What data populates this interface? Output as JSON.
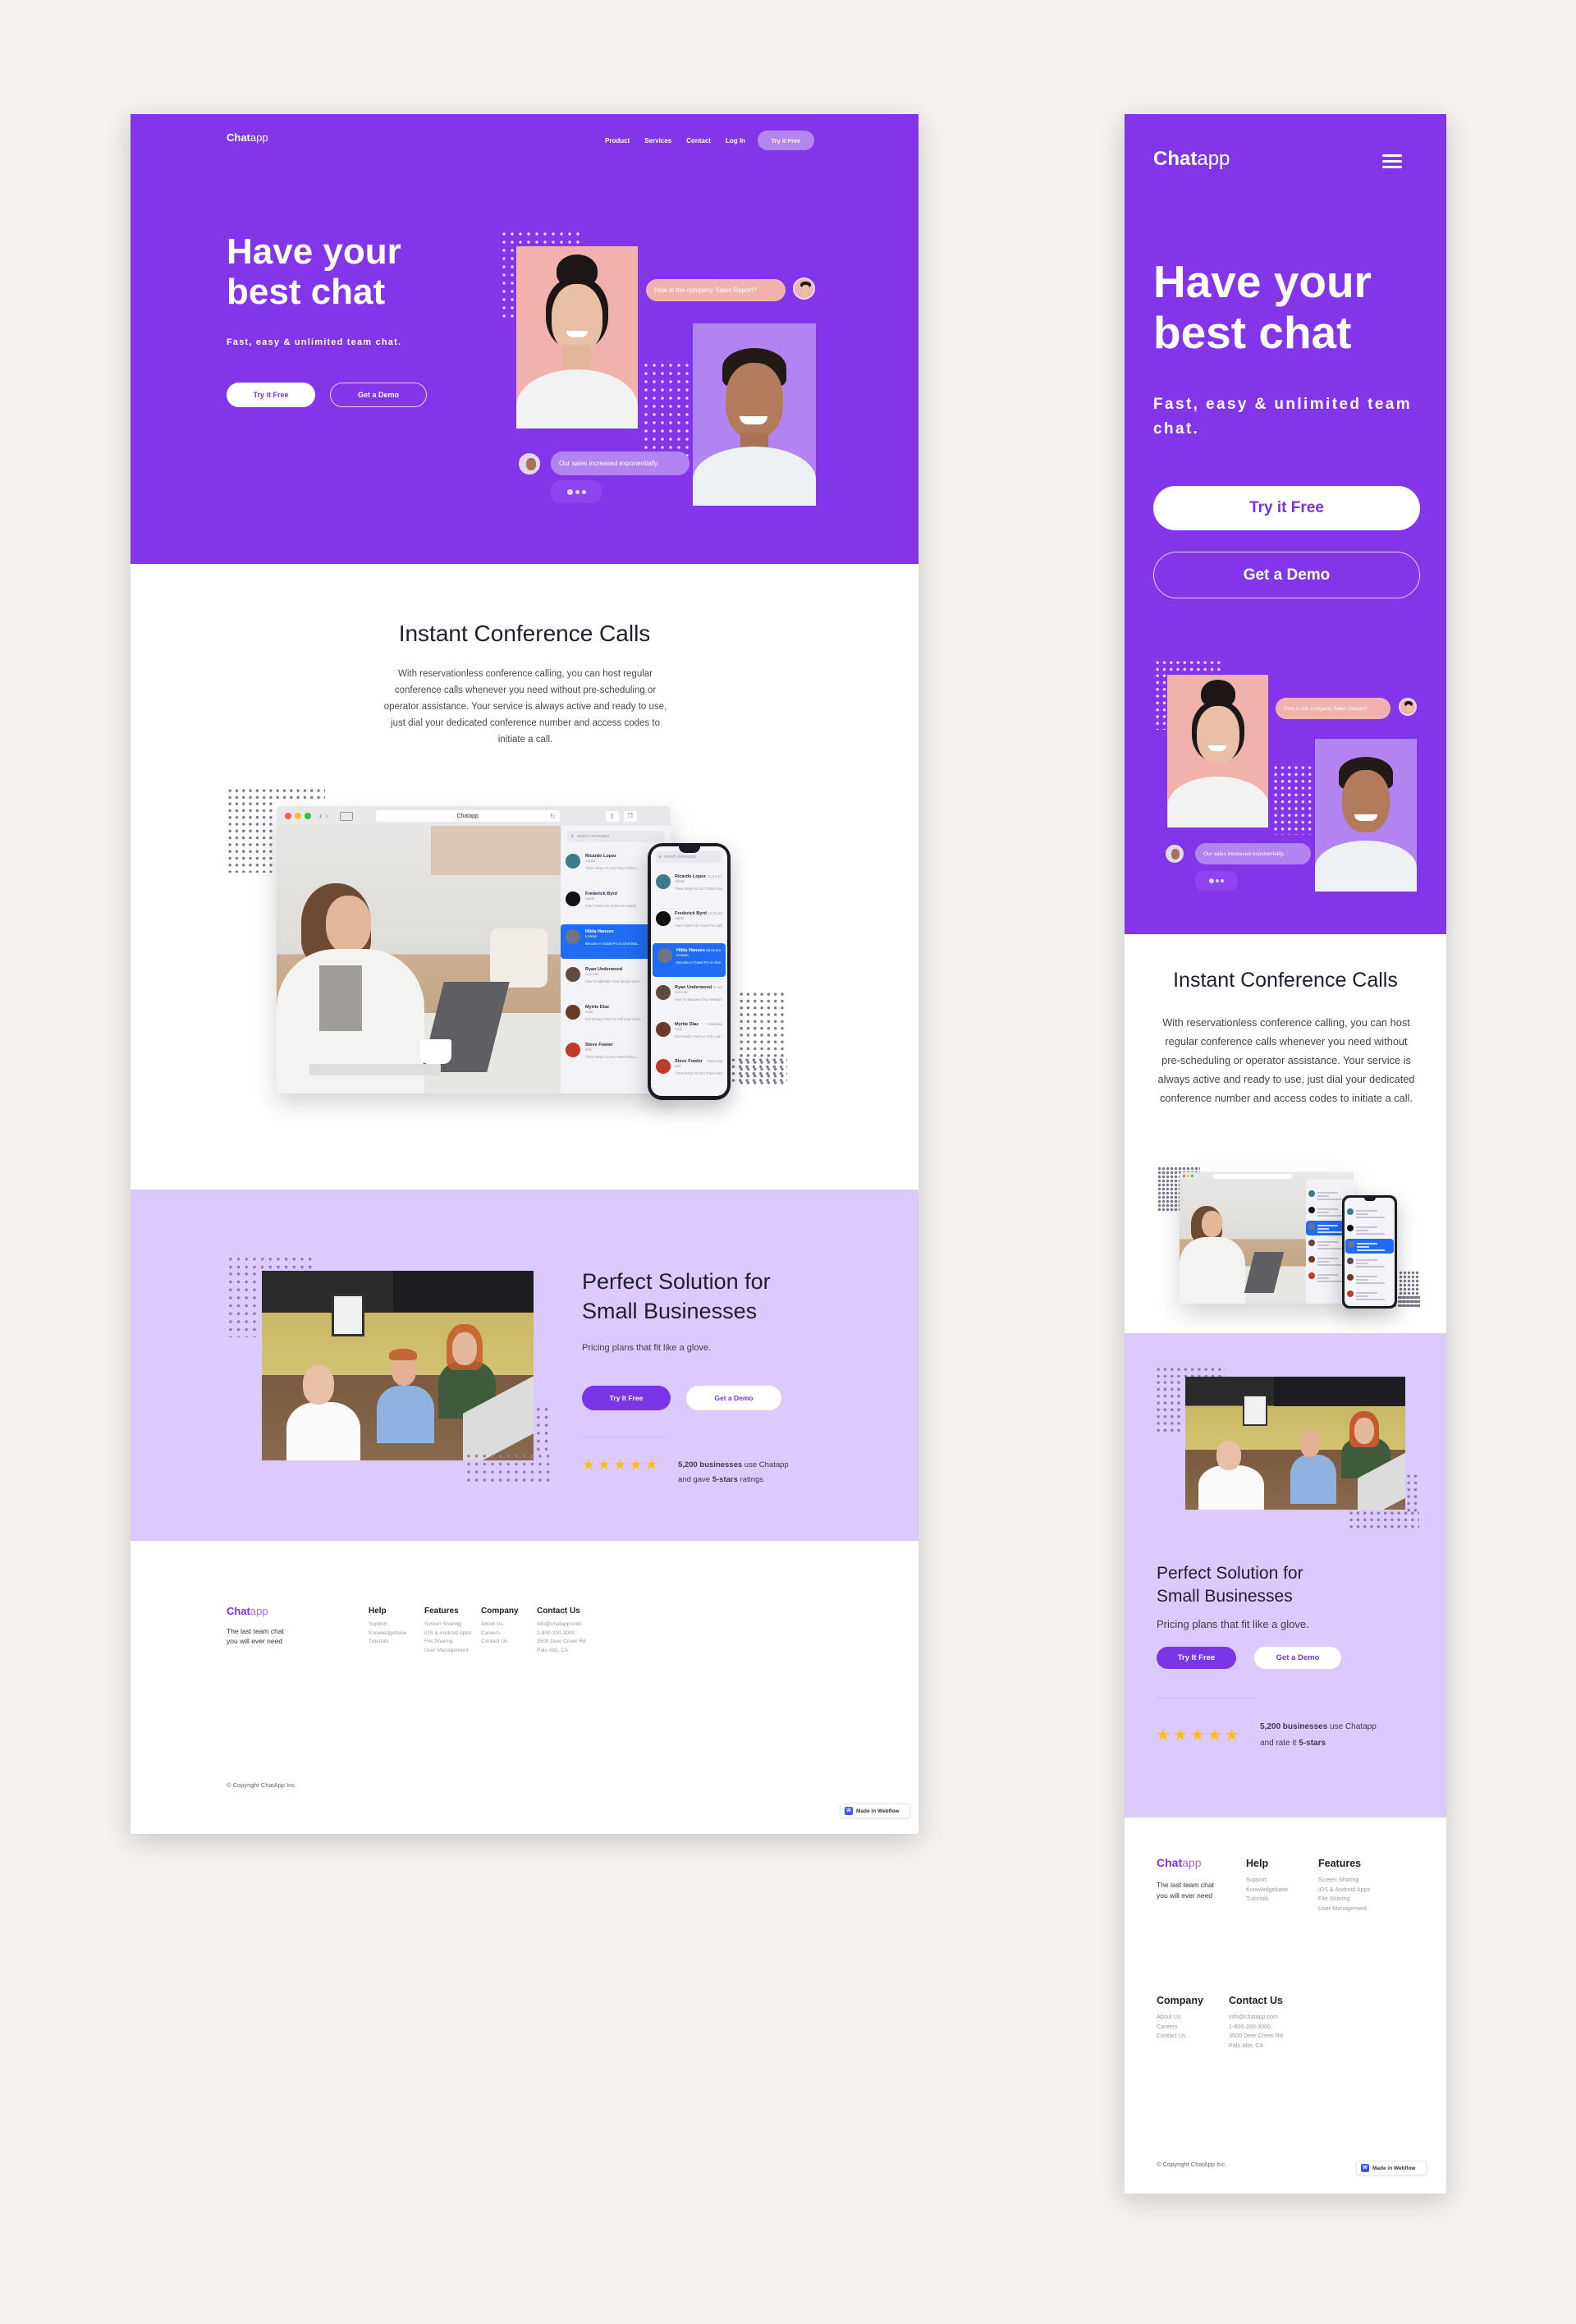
{
  "brand": {
    "name_bold": "Chat",
    "name_light": "app",
    "primary": "#8336e8",
    "lilac": "#dccafc",
    "accent_blue": "#1f6cf5"
  },
  "nav": {
    "items": [
      "Product",
      "Services",
      "Contact",
      "Log In"
    ],
    "cta": "Try it Free",
    "menu_icon": "hamburger-icon"
  },
  "hero": {
    "title_line1": "Have your",
    "title_line2": "best chat",
    "subtitle": "Fast, easy & unlimited team chat.",
    "primary_button": "Try it Free",
    "secondary_button": "Get a Demo",
    "bubble_question": "How is the company Sales Report?",
    "bubble_answer": "Our sales increased exponentially.",
    "typing_indicator": "typing-dots"
  },
  "conference": {
    "title": "Instant Conference Calls",
    "body": "With reservationless conference calling, you can host regular conference calls whenever you need without pre-scheduling or operator assistance. Your service is always active and ready to use, just dial your dedicated conference number and access codes to initiate a call.",
    "browser_title": "Chatapp",
    "search_placeholder": "search messages",
    "chats": [
      {
        "name": "Ricardo Lopez",
        "company": "Adobe",
        "preview": "Three Ways To Get Travel Disco...",
        "time": "11:23 am",
        "active": false
      },
      {
        "name": "Frederick Byrd",
        "company": "Apple",
        "preview": "Train Travel On Track For Safety",
        "time": "10:11 am",
        "active": false
      },
      {
        "name": "Hilda Hansen",
        "company": "Invision",
        "preview": "Become A Travel Pro In One Eas...",
        "time": "08:43 am",
        "active": true
      },
      {
        "name": "Ryan Underwood",
        "company": "Avocode",
        "preview": "How To Maintain Your Mental Heal...",
        "time": "7:11 am",
        "active": false
      },
      {
        "name": "Myrtie Diaz",
        "company": "Audi",
        "preview": "Get Ready Fast For Fall Leaf Viewi...",
        "time": "Yesterday",
        "active": false
      },
      {
        "name": "Steve Fowler",
        "company": "Dell",
        "preview": "Three Ways To Get Travel Disco...",
        "time": "Yesterday",
        "active": false
      }
    ]
  },
  "solution": {
    "title_line1": "Perfect Solution for",
    "title_line2": "Small Businesses",
    "subtitle": "Pricing plans that fit like a glove.",
    "primary_button": "Try It Free",
    "secondary_button": "Get a Demo",
    "rating": 5,
    "rating_max": 5,
    "stat_bold": "5,200 businesses",
    "stat_rest": " use Chatapp",
    "desktop_line2_pre": "and gave ",
    "desktop_line2_bold": "5-stars",
    "desktop_line2_post": " ratings",
    "mobile_line2_pre": "and rate it ",
    "mobile_line2_bold": "5-stars"
  },
  "footer": {
    "tagline_line1": "The last team chat",
    "tagline_line2": "you will ever need",
    "columns": [
      {
        "title": "Help",
        "links": [
          "Support",
          "Knowledgebase",
          "Tutorials"
        ]
      },
      {
        "title": "Features",
        "links": [
          "Screen Sharing",
          "iOS & Android Apps",
          "File Sharing",
          "User Management"
        ]
      },
      {
        "title": "Company",
        "links": [
          "About Us",
          "Careers",
          "Contact Us"
        ]
      },
      {
        "title": "Contact Us",
        "links": [
          "info@chatapp.com",
          "1-800-200-3000",
          "3500 Deer Creek Rd",
          "Palo Alto, CA"
        ]
      }
    ],
    "copyright": "© Copyright ChatApp Inc.",
    "badge": "Made in Webflow",
    "badge_icon": "W"
  }
}
